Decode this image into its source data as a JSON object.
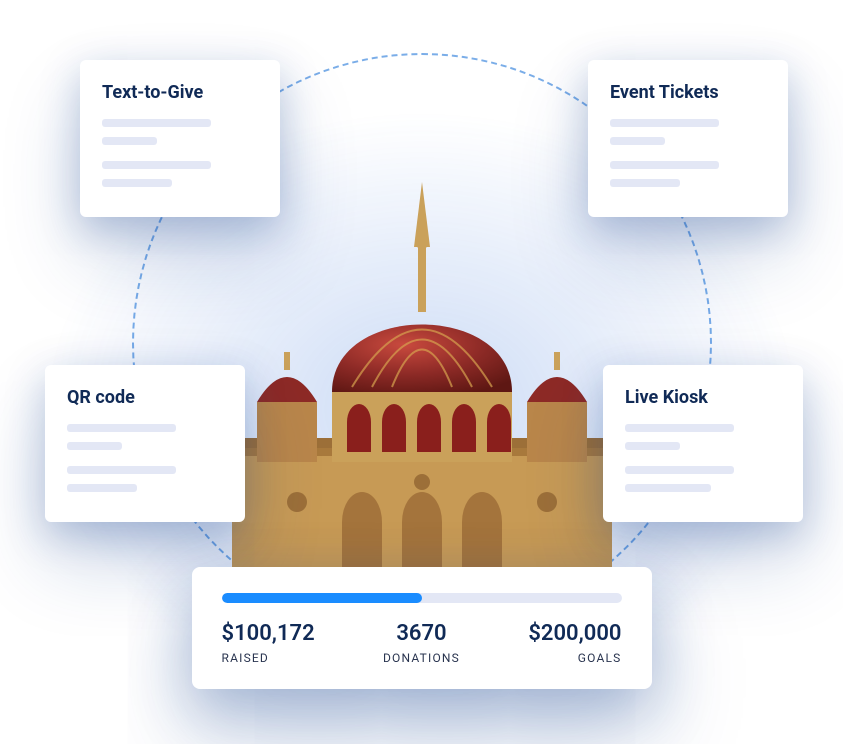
{
  "cards": {
    "top_left": {
      "title": "Text-to-Give"
    },
    "top_right": {
      "title": "Event Tickets"
    },
    "bottom_left": {
      "title": "QR code"
    },
    "bottom_right": {
      "title": "Live Kiosk"
    }
  },
  "stats": {
    "raised": {
      "value": "$100,172",
      "label": "RAISED"
    },
    "donations": {
      "value": "3670",
      "label": "DONATIONS"
    },
    "goals": {
      "value": "$200,000",
      "label": "GOALS"
    },
    "progress_percent": 50
  },
  "colors": {
    "brand_navy": "#102a56",
    "brand_blue": "#1a8cff",
    "placeholder": "#e3e7f5"
  },
  "center_image": {
    "description": "mosque-with-red-dome"
  }
}
